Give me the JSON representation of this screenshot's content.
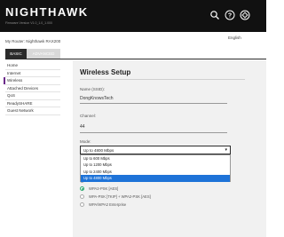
{
  "header": {
    "brand": "NIGHTHAWK",
    "firmware_line": "Firmware Version V1.0_1.0_1.000",
    "icons": [
      "search-icon",
      "help-icon",
      "gear-icon"
    ]
  },
  "router_line": "My Router: Nighthawk RAX200",
  "language": "English",
  "tabs": [
    {
      "label": "BASIC",
      "active": true
    },
    {
      "label": "ADVANCED",
      "active": false
    }
  ],
  "sidebar": {
    "items": [
      {
        "label": "Home"
      },
      {
        "label": "Internet"
      },
      {
        "label": "Wireless"
      },
      {
        "label": "Attached Devices"
      },
      {
        "label": "QoS"
      },
      {
        "label": "ReadySHARE"
      },
      {
        "label": "Guest Network"
      }
    ]
  },
  "main": {
    "title": "Wireless Setup",
    "ssid_label": "Name (SSID):",
    "ssid_value": "DongKnowsTech",
    "channel_label": "Channel:",
    "channel_value": "44",
    "mode_label": "Mode:",
    "mode_value": "Up to 4800 Mbps",
    "mode_options": [
      {
        "label": "Up to 600 Mbps",
        "selected": false
      },
      {
        "label": "Up to 1200 Mbps",
        "selected": false
      },
      {
        "label": "Up to 2400 Mbps",
        "selected": false
      },
      {
        "label": "Up to 4800 Mbps",
        "selected": true
      }
    ],
    "security_label": "Security Options",
    "security_options": [
      {
        "label": "None",
        "checked": false
      },
      {
        "label": "WPA2-PSK [AES]",
        "checked": true
      },
      {
        "label": "WPA-PSK [TKIP] + WPA2-PSK [AES]",
        "checked": false
      },
      {
        "label": "WPA/WPA2 Enterprise",
        "checked": false
      }
    ]
  },
  "colors": {
    "header_bg": "#111111",
    "active_tab": "#2b2b2b",
    "accent_purple": "#6b2a8a",
    "selection_blue": "#1e73d8",
    "radio_green": "#2da96f"
  }
}
